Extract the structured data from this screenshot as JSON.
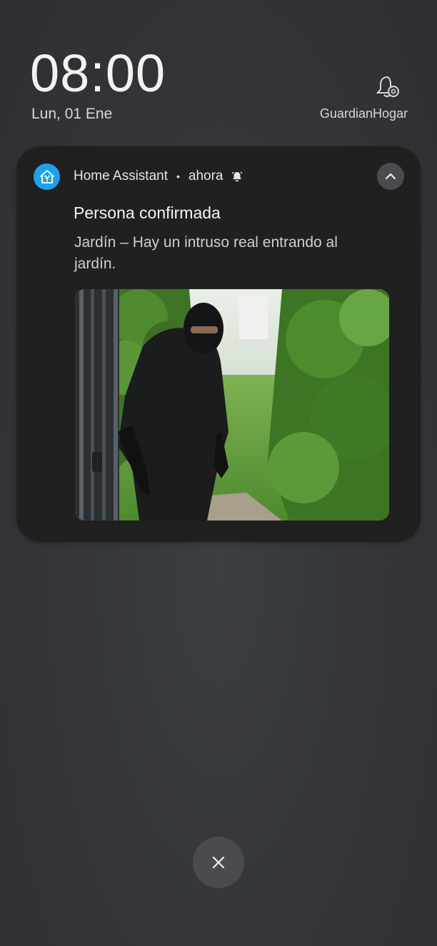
{
  "lockscreen": {
    "time": "08:00",
    "date": "Lun, 01 Ene",
    "owner_name": "GuardianHogar",
    "owner_icon": "bell-settings-icon"
  },
  "notification": {
    "app_name": "Home Assistant",
    "separator": "•",
    "time_label": "ahora",
    "app_icon": "home-assistant-icon",
    "alarm_icon": "alarm-bell-icon",
    "title": "Persona confirmada",
    "message": "Jardín – Hay un intruso real entrando al jardín.",
    "image_description_icon": "camera-snapshot",
    "accent_color": "#1fa1ea"
  },
  "actions": {
    "clear_icon": "close-icon"
  }
}
